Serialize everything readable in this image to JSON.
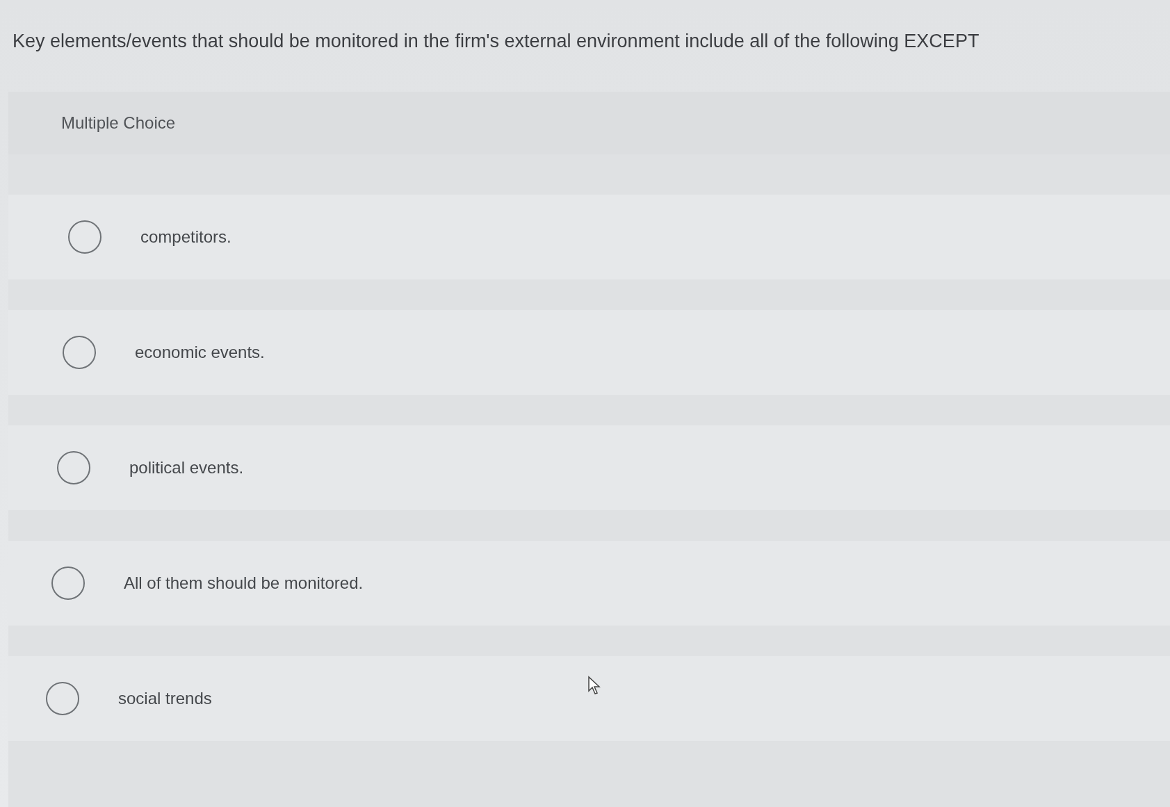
{
  "question": "Key elements/events that should be monitored in the firm's external environment include all of the following EXCEPT",
  "section": {
    "label": "Multiple Choice"
  },
  "options": [
    {
      "label": "competitors.",
      "selected": false
    },
    {
      "label": "economic events.",
      "selected": false
    },
    {
      "label": "political events.",
      "selected": false
    },
    {
      "label": "All of them should be monitored.",
      "selected": false
    },
    {
      "label": "social trends",
      "selected": false
    }
  ]
}
